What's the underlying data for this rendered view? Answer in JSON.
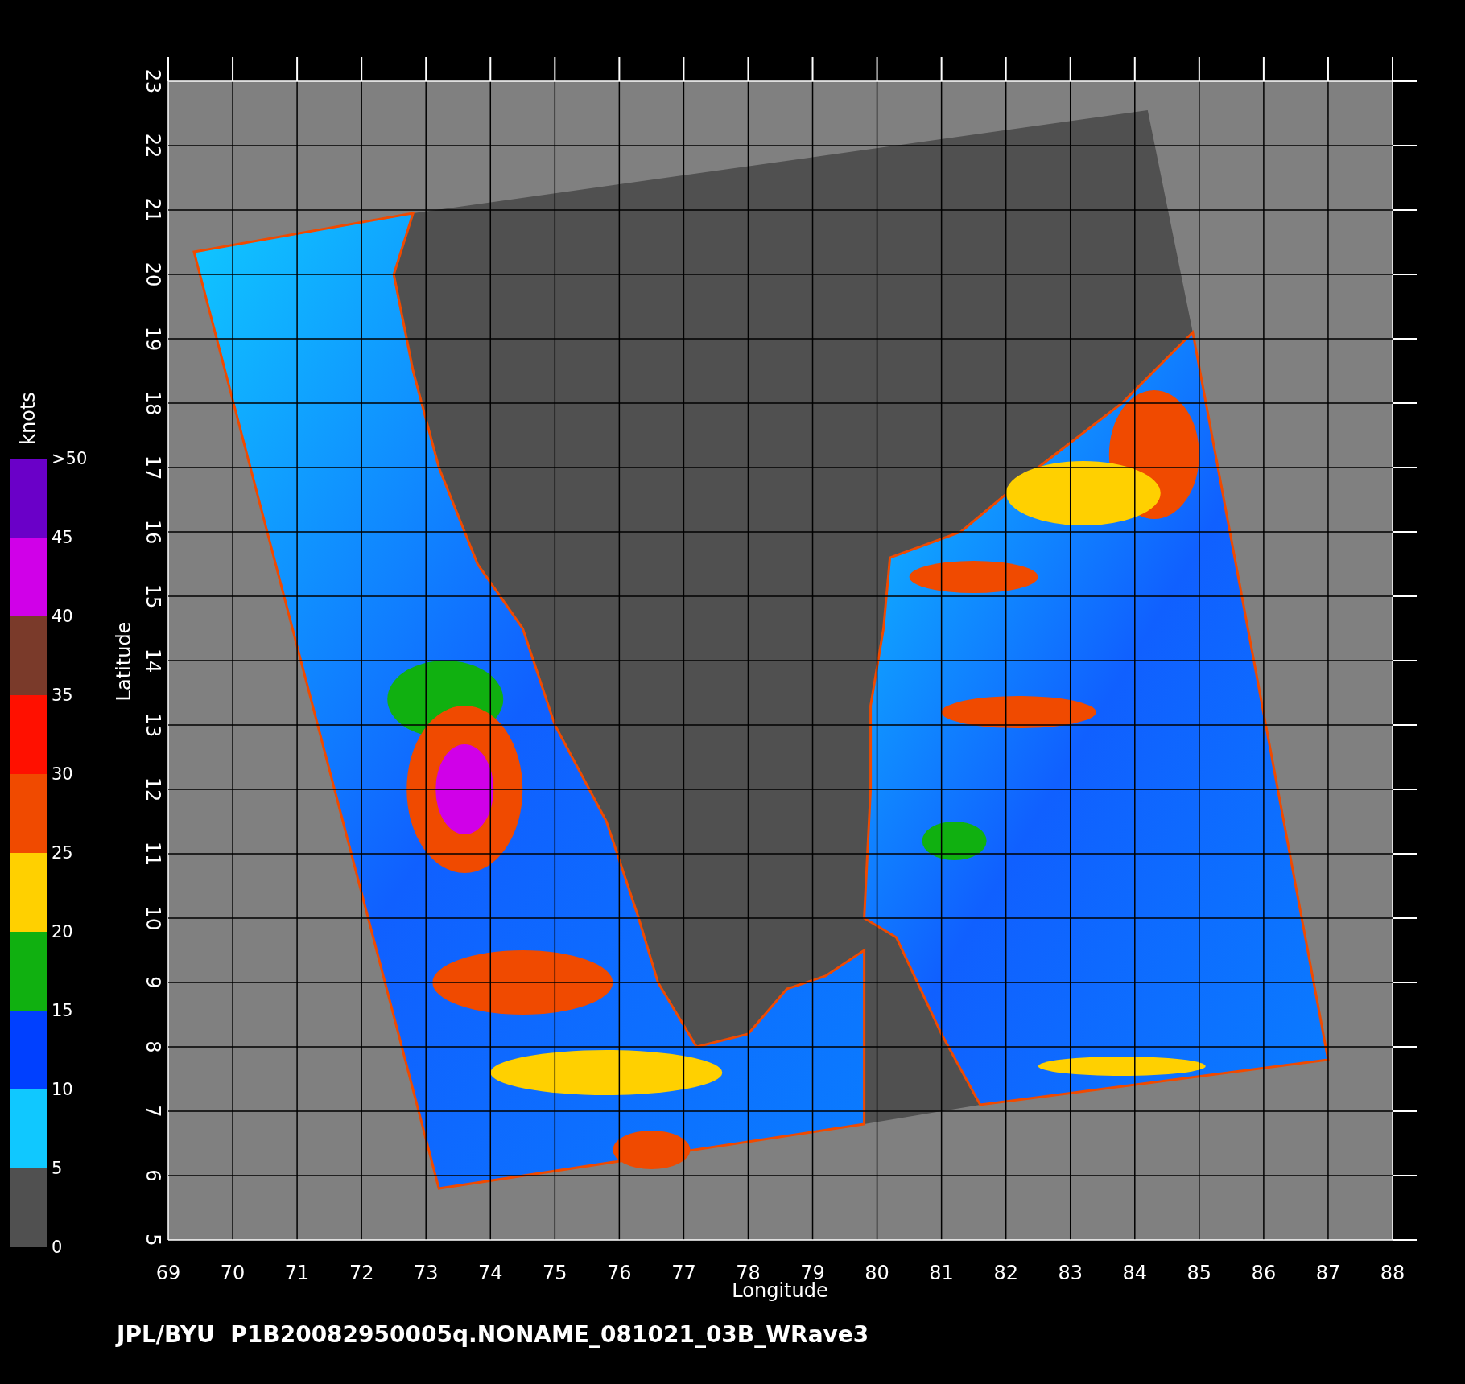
{
  "colorbar": {
    "unit": "knots",
    "bottom_label": "0",
    "bands": [
      {
        "label": ">50",
        "color": "#6a00c8"
      },
      {
        "label": "45",
        "color": "#d000e8"
      },
      {
        "label": "40",
        "color": "#7a3a2a"
      },
      {
        "label": "35",
        "color": "#ff1000"
      },
      {
        "label": "30",
        "color": "#f04a00"
      },
      {
        "label": "25",
        "color": "#ffd000"
      },
      {
        "label": "20",
        "color": "#10b010"
      },
      {
        "label": "15",
        "color": "#0040ff"
      },
      {
        "label": "10",
        "color": "#10c8ff"
      },
      {
        "label": "5",
        "color": "#505050"
      }
    ]
  },
  "map": {
    "xlabel": "Longitude",
    "ylabel": "Latitude",
    "x_ticks": [
      "69",
      "70",
      "71",
      "72",
      "73",
      "74",
      "75",
      "76",
      "77",
      "78",
      "79",
      "80",
      "81",
      "82",
      "83",
      "84",
      "85",
      "86",
      "87",
      "88"
    ],
    "y_ticks": [
      "5",
      "6",
      "7",
      "8",
      "9",
      "10",
      "11",
      "12",
      "13",
      "14",
      "15",
      "16",
      "17",
      "18",
      "19",
      "20",
      "21",
      "22",
      "23"
    ]
  },
  "caption": "JPL/BYU  P1B20082950005q.NONAME_081021_03B_WRave3"
}
